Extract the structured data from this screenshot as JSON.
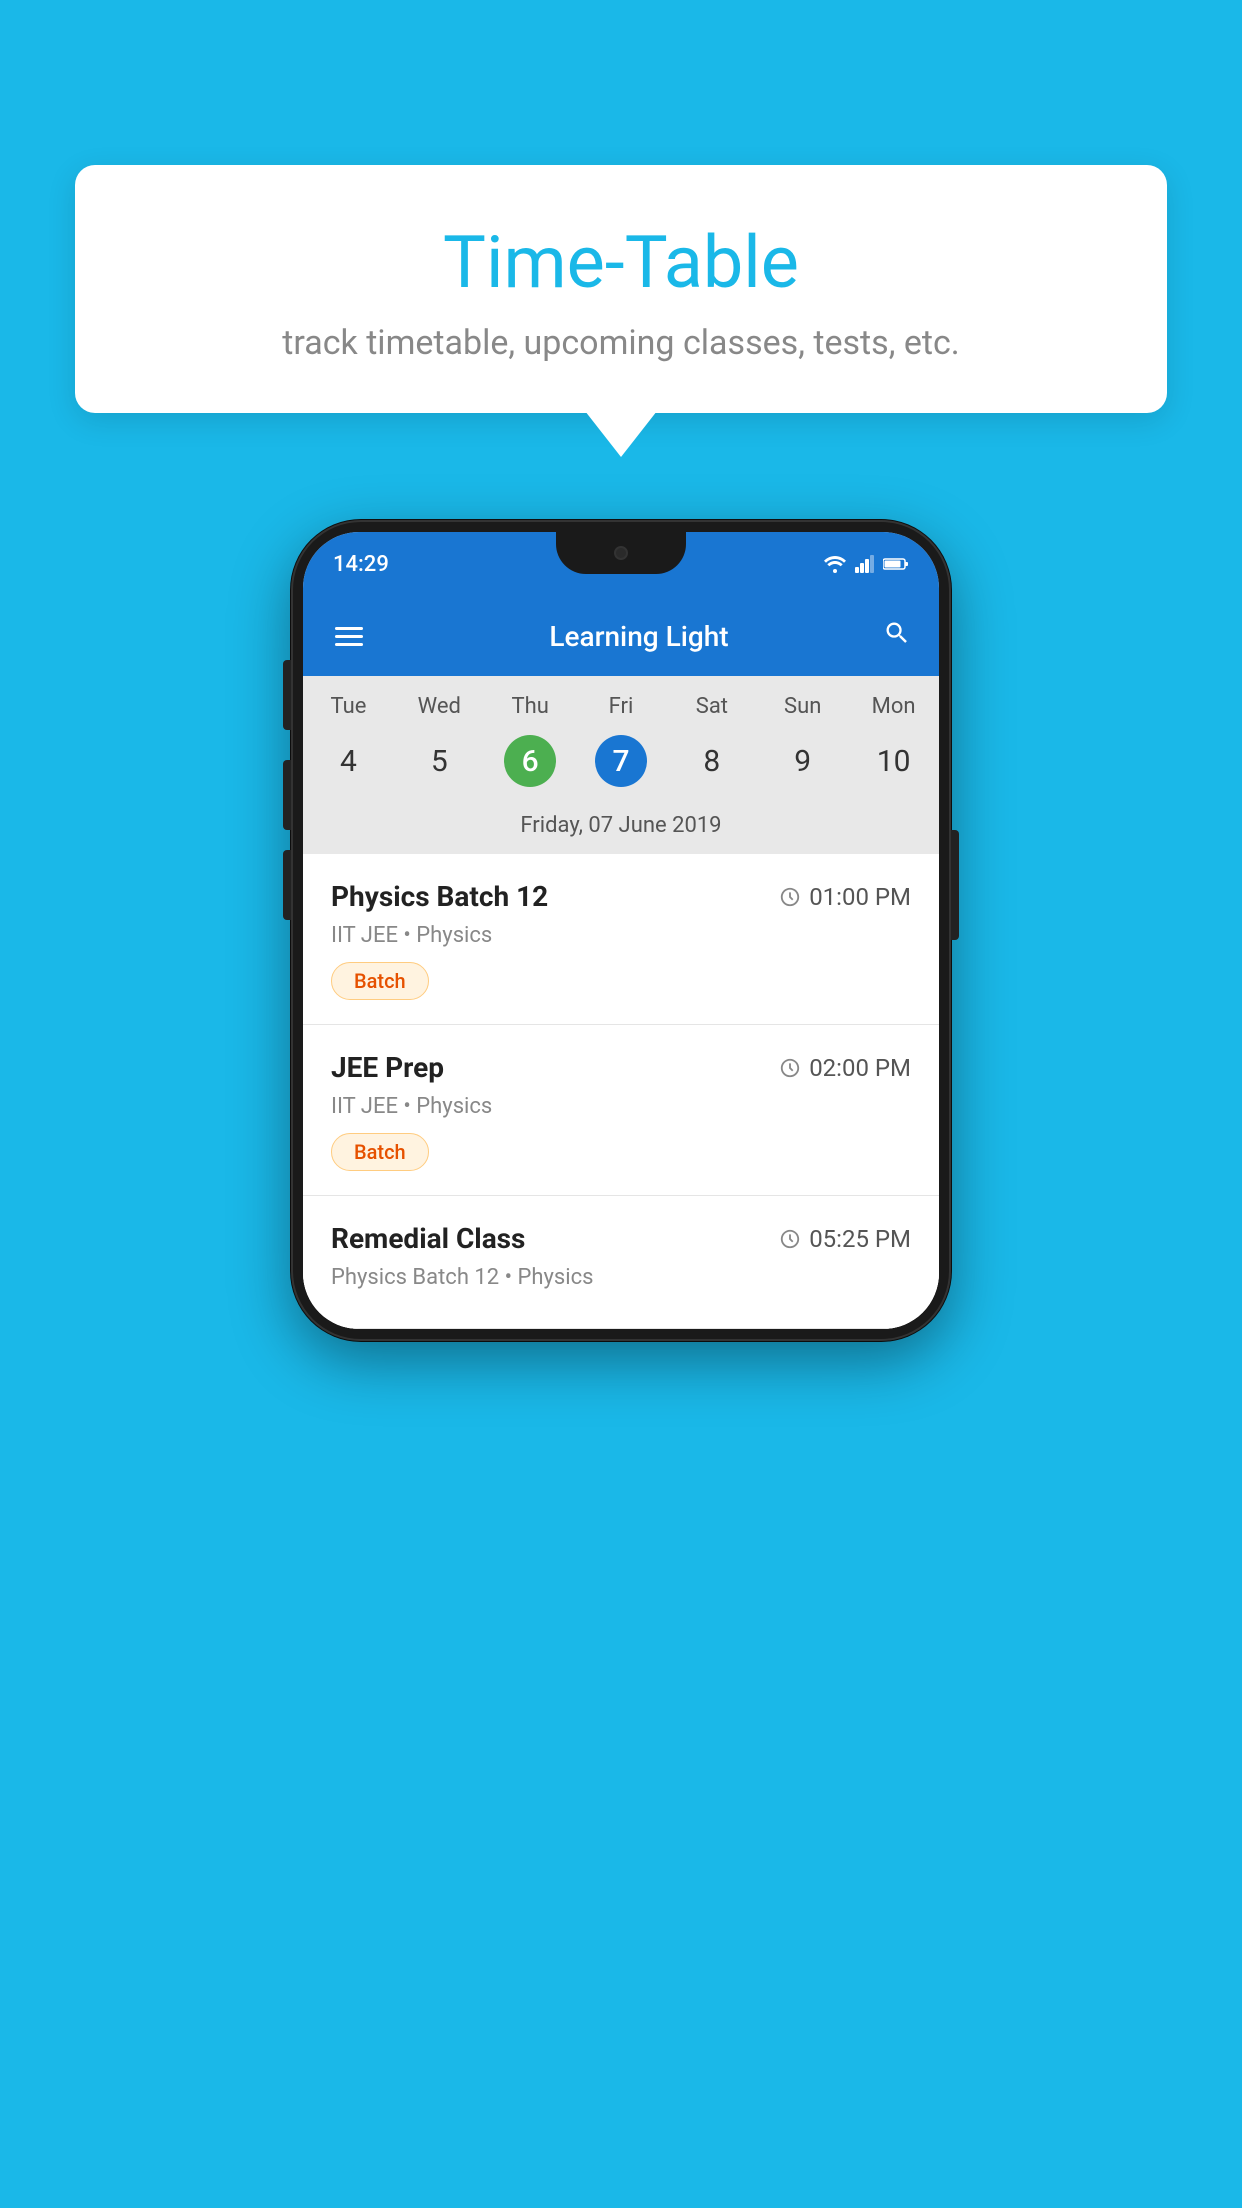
{
  "background_color": "#1ab8e8",
  "tooltip": {
    "title": "Time-Table",
    "subtitle": "track timetable, upcoming classes, tests, etc."
  },
  "phone": {
    "status_bar": {
      "time": "14:29"
    },
    "app_bar": {
      "title": "Learning Light"
    },
    "calendar": {
      "days": [
        {
          "label": "Tue",
          "number": "4"
        },
        {
          "label": "Wed",
          "number": "5"
        },
        {
          "label": "Thu",
          "number": "6",
          "state": "today"
        },
        {
          "label": "Fri",
          "number": "7",
          "state": "selected"
        },
        {
          "label": "Sat",
          "number": "8"
        },
        {
          "label": "Sun",
          "number": "9"
        },
        {
          "label": "Mon",
          "number": "10"
        }
      ],
      "selected_date_label": "Friday, 07 June 2019"
    },
    "schedule": [
      {
        "title": "Physics Batch 12",
        "time": "01:00 PM",
        "subtitle": "IIT JEE • Physics",
        "tag": "Batch"
      },
      {
        "title": "JEE Prep",
        "time": "02:00 PM",
        "subtitle": "IIT JEE • Physics",
        "tag": "Batch"
      },
      {
        "title": "Remedial Class",
        "time": "05:25 PM",
        "subtitle": "Physics Batch 12 • Physics",
        "tag": ""
      }
    ]
  }
}
